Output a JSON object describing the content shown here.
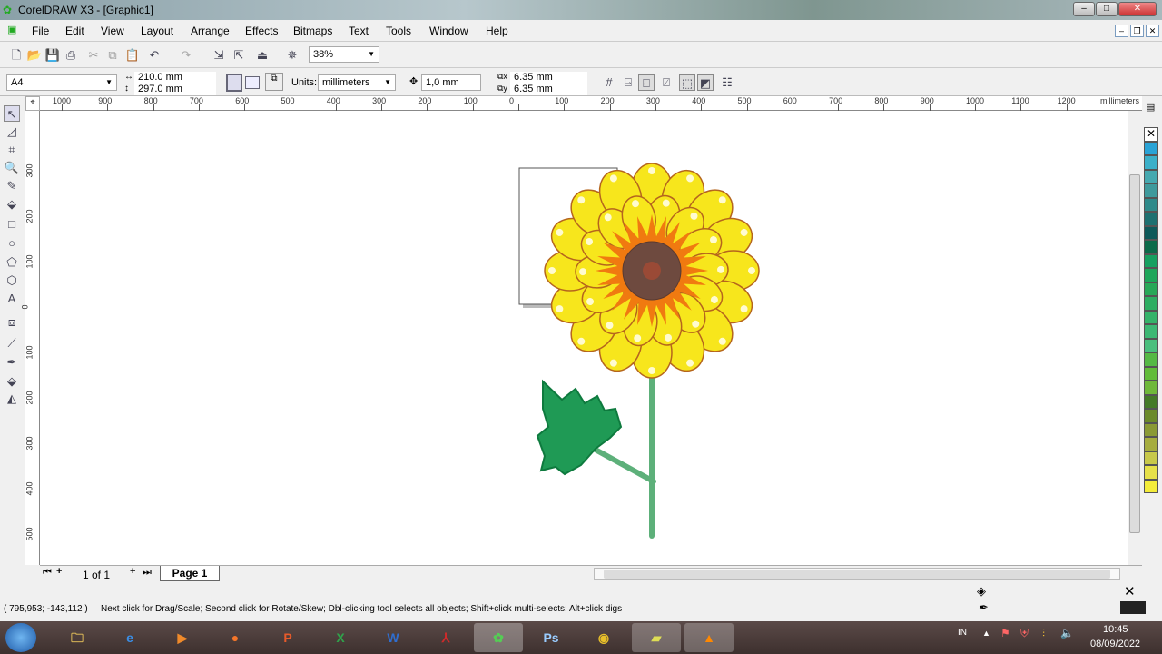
{
  "window": {
    "title": "CorelDRAW X3 - [Graphic1]"
  },
  "menu": [
    "File",
    "Edit",
    "View",
    "Layout",
    "Arrange",
    "Effects",
    "Bitmaps",
    "Text",
    "Tools",
    "Window",
    "Help"
  ],
  "toolbar": {
    "zoom": "38%"
  },
  "property_bar": {
    "page_size": "A4",
    "width": "210.0 mm",
    "height": "297.0 mm",
    "units_label": "Units:",
    "units": "millimeters",
    "nudge": "1,0 mm",
    "dup_x": "6.35 mm",
    "dup_y": "6.35 mm"
  },
  "ruler": {
    "top_labels": [
      "1000",
      "900",
      "800",
      "700",
      "600",
      "500",
      "400",
      "300",
      "200",
      "100",
      "0",
      "100",
      "200",
      "300",
      "400",
      "500",
      "600",
      "700",
      "800",
      "900",
      "1000",
      "1100",
      "1200"
    ],
    "unit": "millimeters",
    "left_labels": [
      "300",
      "200",
      "100",
      "0",
      "100",
      "200",
      "300",
      "400",
      "500"
    ]
  },
  "pages": {
    "counter": "1 of 1",
    "tab": "Page 1"
  },
  "status": {
    "coords": "( 795,953; -143,112 )",
    "hint": "Next click for Drag/Scale; Second click for Rotate/Skew; Dbl-clicking tool selects all objects; Shift+click multi-selects; Alt+click digs"
  },
  "palette": [
    "#29a3d6",
    "#3bb0c9",
    "#46a9b0",
    "#3f9a9c",
    "#2f8a8a",
    "#1d7070",
    "#0e5a5a",
    "#0b6b4a",
    "#16a060",
    "#1ea65a",
    "#28a858",
    "#2eae62",
    "#35b36a",
    "#3db874",
    "#4abf7d",
    "#55b945",
    "#62bc3a",
    "#6fb83a",
    "#447a28",
    "#6b8a2a",
    "#8a9a35",
    "#a6ad3f",
    "#c8c84a",
    "#e6e04a",
    "#f3ec3a"
  ],
  "taskbar": {
    "lang": "IN",
    "time": "10:45",
    "date": "08/09/2022",
    "apps": [
      "Explorer",
      "Internet Explorer",
      "Media Player",
      "Firefox",
      "PowerPoint",
      "Excel",
      "Word",
      "Acrobat",
      "CorelDRAW",
      "Photoshop",
      "Chrome",
      "Sticky Notes",
      "VLC"
    ]
  }
}
